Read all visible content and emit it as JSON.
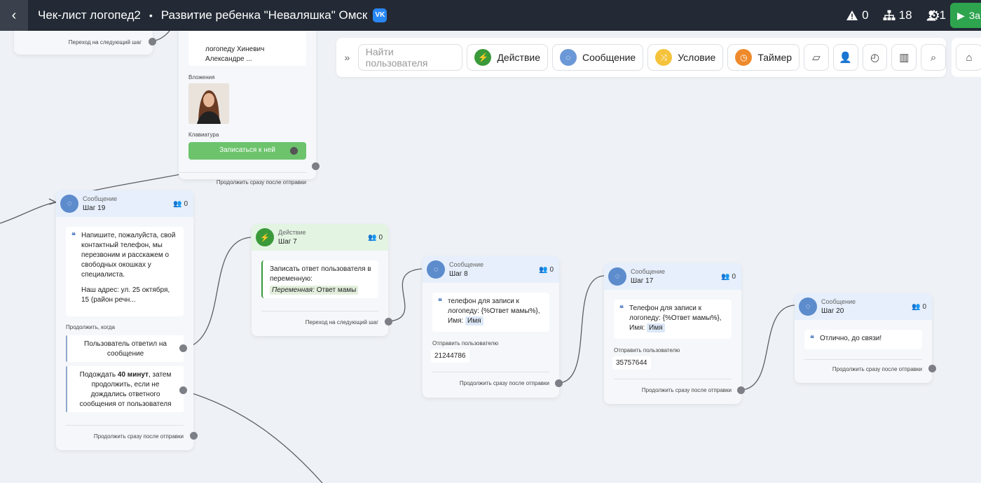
{
  "header": {
    "back_icon": "chevron-left-icon",
    "bot_name": "Чек-лист логопед2",
    "separator": "•",
    "project_name": "Развитие ребенка \"Неваляшка\" Омск",
    "vk_label": "VK",
    "warnings": "0",
    "steps": "18",
    "users": "1",
    "run_label": "За"
  },
  "toolbar": {
    "search_placeholder": "Найти пользователя",
    "action": "Действие",
    "message": "Сообщение",
    "condition": "Условие",
    "timer": "Таймер",
    "colors": {
      "action": "#3a9a3a",
      "message": "#6b98d6",
      "condition": "#f5c33b",
      "timer": "#ef8a2c"
    }
  },
  "nodes": {
    "top_left": {
      "footer": "Переход на следующий шаг"
    },
    "top_mid": {
      "text_line1": "логопеду Хиневич",
      "text_line2": "Александре ...",
      "attachments_label": "Вложения",
      "keyboard_label": "Клавиатура",
      "keyboard_button": "Записаться к ней",
      "footer": "Продолжить сразу после отправки"
    },
    "step19": {
      "type": "Сообщение",
      "name": "Шаг 19",
      "count": "0",
      "text_p1": "Напишите, пожалуйста, свой контактный телефон, мы перезвоним и расскажем о свободных окошках у специалиста.",
      "text_p2": "Наш адрес: ул. 25 октября, 15 (район речн...",
      "continue_label": "Продолжить, когда",
      "cond1": "Пользователь ответил на сообщение",
      "cond2_pre": "Подождать ",
      "cond2_bold": "40 минут",
      "cond2_post": ", затем продолжить, если не дождались ответного сообщения от пользователя",
      "footer": "Продолжить сразу после отправки"
    },
    "step7": {
      "type": "Действие",
      "name": "Шаг 7",
      "count": "0",
      "text": "Записать ответ пользователя в переменную:",
      "var_label": "Переменная:",
      "var_value": "Ответ мамы",
      "footer": "Переход на следующий шаг"
    },
    "step8": {
      "type": "Сообщение",
      "name": "Шаг 8",
      "count": "0",
      "text": "телефон для записи к логопеду: {%Ответ мамы%}, Имя:",
      "name_tag": "Имя",
      "send_label": "Отправить пользователю",
      "send_value": "21244786",
      "footer": "Продолжить сразу после отправки"
    },
    "step17": {
      "type": "Сообщение",
      "name": "Шаг 17",
      "count": "0",
      "text": "Телефон для записи к логопеду: {%Ответ мамы%}, Имя:",
      "name_tag": "Имя",
      "send_label": "Отправить пользователю",
      "send_value": "35757644",
      "footer": "Продолжить сразу после отправки"
    },
    "step20": {
      "type": "Сообщение",
      "name": "Шаг 20",
      "count": "0",
      "text": "Отлично, до связи!",
      "footer": "Продолжить сразу после отправки"
    }
  }
}
